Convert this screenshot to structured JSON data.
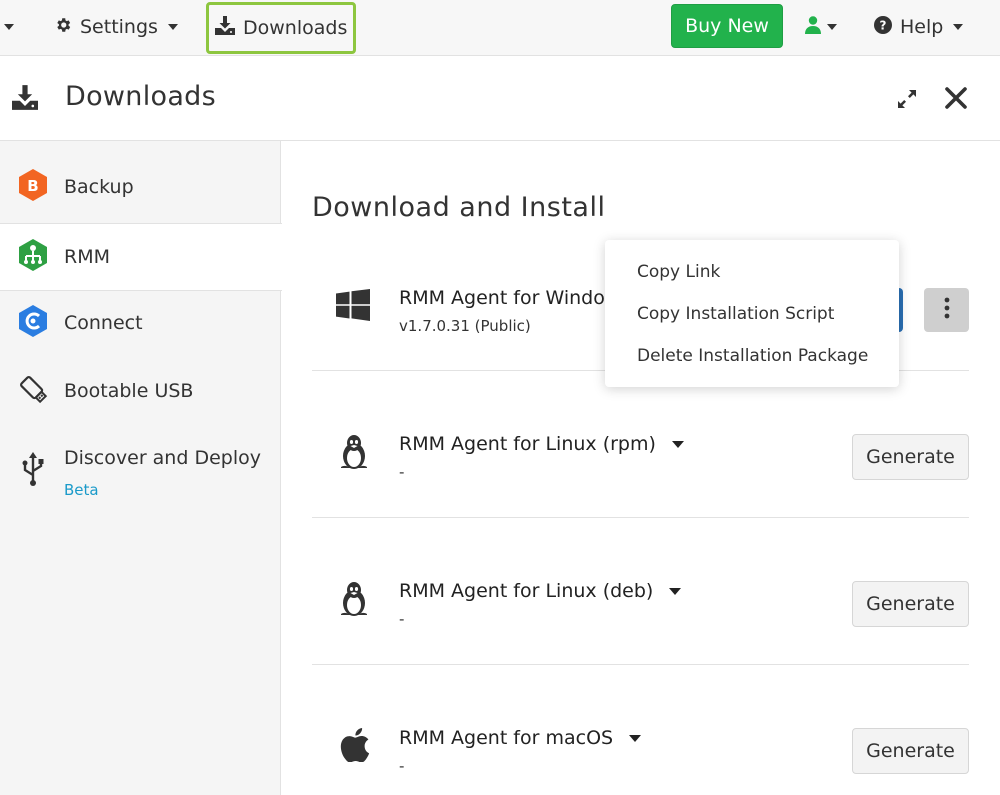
{
  "topbar": {
    "settings_label": "Settings",
    "downloads_label": "Downloads",
    "buy_label": "Buy New",
    "help_label": "Help"
  },
  "panel": {
    "title": "Downloads"
  },
  "sidebar": {
    "items": [
      {
        "label": "Backup"
      },
      {
        "label": "RMM"
      },
      {
        "label": "Connect"
      },
      {
        "label": "Bootable USB"
      },
      {
        "label": "Discover and Deploy",
        "badge": "Beta"
      }
    ]
  },
  "main": {
    "title": "Download and Install",
    "packages": [
      {
        "name": "RMM Agent for Windo",
        "version": "v1.7.0.31 (Public)"
      },
      {
        "name": "RMM Agent for Linux (rpm)",
        "version": "-",
        "button": "Generate"
      },
      {
        "name": "RMM Agent for Linux (deb)",
        "version": "-",
        "button": "Generate"
      },
      {
        "name": "RMM Agent for macOS",
        "version": "-",
        "button": "Generate"
      }
    ]
  },
  "context_menu": {
    "items": [
      "Copy Link",
      "Copy Installation Script",
      "Delete Installation Package"
    ]
  },
  "colors": {
    "accent_green": "#22b24c",
    "highlight_border": "#8dc63f",
    "beta_blue": "#1a9ac9",
    "primary_blue": "#2a6fb4"
  }
}
